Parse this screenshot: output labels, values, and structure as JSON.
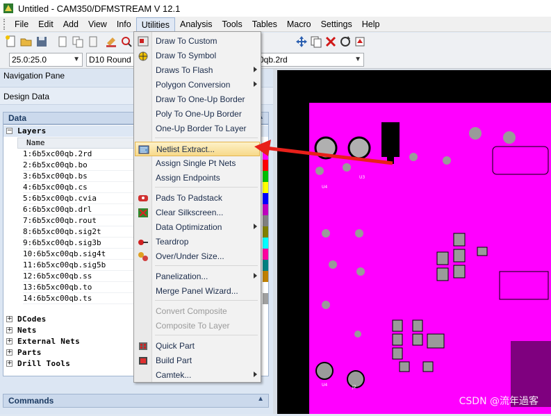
{
  "window": {
    "title": "Untitled  -  CAM350/DFMSTREAM V 12.1"
  },
  "menubar": [
    "File",
    "Edit",
    "Add",
    "View",
    "Info",
    "Utilities",
    "Analysis",
    "Tools",
    "Tables",
    "Macro",
    "Settings",
    "Help"
  ],
  "toolbar2": {
    "coord_value": "25.0:25.0",
    "dcode_value": "D10  Round",
    "layer_value": "0qb.2rd"
  },
  "nav": {
    "pane_title": "Navigation Pane",
    "design_data": "Design Data",
    "data_header": "Data",
    "layers_label": "Layers",
    "column_name": "Name",
    "layers": [
      {
        "name": "1:6b5xc00qb.2rd",
        "color": "#ff00ff"
      },
      {
        "name": "2:6b5xc00qb.bo",
        "color": "#ff0000"
      },
      {
        "name": "3:6b5xc00qb.bs",
        "color": "#00c000"
      },
      {
        "name": "4:6b5xc00qb.cs",
        "color": "#ffff00"
      },
      {
        "name": "5:6b5xc00qb.cvia",
        "color": "#0000ff"
      },
      {
        "name": "6:6b5xc00qb.drl",
        "color": "#c000c0"
      },
      {
        "name": "7:6b5xc00qb.rout",
        "color": "#808080"
      },
      {
        "name": "8:6b5xc00qb.sig2t",
        "color": "#808000"
      },
      {
        "name": "9:6b5xc00qb.sig3b",
        "color": "#00ffff"
      },
      {
        "name": "10:6b5xc00qb.sig4t",
        "color": "#ff00a0"
      },
      {
        "name": "11:6b5xc00qb.sig5b",
        "color": "#008080"
      },
      {
        "name": "12:6b5xc00qb.ss",
        "color": "#c08000"
      },
      {
        "name": "13:6b5xc00qb.to",
        "color": "#ffffff"
      },
      {
        "name": "14:6b5xc00qb.ts",
        "color": "#a0a0a0"
      }
    ],
    "groups": [
      "DCodes",
      "Nets",
      "External Nets",
      "Parts",
      "Drill Tools"
    ],
    "commands": "Commands"
  },
  "utilities_menu": {
    "items": [
      {
        "label": "Draw To Custom",
        "icon": "draw-custom-icon",
        "submenu": false,
        "disabled": false
      },
      {
        "label": "Draw To Symbol",
        "icon": "draw-symbol-icon",
        "submenu": false,
        "disabled": false
      },
      {
        "label": "Draws To Flash",
        "icon": "",
        "submenu": true,
        "disabled": false
      },
      {
        "label": "Polygon Conversion",
        "icon": "",
        "submenu": true,
        "disabled": false
      },
      {
        "label": "Draw To One-Up Border",
        "icon": "",
        "submenu": false,
        "disabled": false
      },
      {
        "label": "Poly To One-Up Border",
        "icon": "",
        "submenu": false,
        "disabled": false
      },
      {
        "label": "One-Up Border To Layer",
        "icon": "",
        "submenu": false,
        "disabled": false
      },
      {
        "label": "Netlist Extract...",
        "icon": "netlist-extract-icon",
        "submenu": false,
        "disabled": false,
        "highlighted": true
      },
      {
        "label": "Assign Single Pt Nets",
        "icon": "",
        "submenu": false,
        "disabled": false
      },
      {
        "label": "Assign Endpoints",
        "icon": "",
        "submenu": false,
        "disabled": false
      },
      {
        "label": "Pads To Padstack",
        "icon": "pads-padstack-icon",
        "submenu": false,
        "disabled": false
      },
      {
        "label": "Clear Silkscreen...",
        "icon": "clear-silkscreen-icon",
        "submenu": false,
        "disabled": false
      },
      {
        "label": "Data Optimization",
        "icon": "",
        "submenu": true,
        "disabled": false
      },
      {
        "label": "Teardrop",
        "icon": "teardrop-icon",
        "submenu": false,
        "disabled": false
      },
      {
        "label": "Over/Under Size...",
        "icon": "over-under-size-icon",
        "submenu": false,
        "disabled": false
      },
      {
        "label": "Panelization...",
        "icon": "",
        "submenu": true,
        "disabled": false
      },
      {
        "label": "Merge Panel Wizard...",
        "icon": "",
        "submenu": false,
        "disabled": false
      },
      {
        "label": "Convert Composite",
        "icon": "",
        "submenu": false,
        "disabled": true
      },
      {
        "label": "Composite To Layer",
        "icon": "",
        "submenu": false,
        "disabled": true
      },
      {
        "label": "Quick Part",
        "icon": "quick-part-icon",
        "submenu": false,
        "disabled": false
      },
      {
        "label": "Build Part",
        "icon": "build-part-icon",
        "submenu": false,
        "disabled": false
      },
      {
        "label": "Camtek...",
        "icon": "",
        "submenu": true,
        "disabled": false
      }
    ]
  },
  "pcb_labels": [
    "U4",
    "J2",
    "U3",
    "U4"
  ],
  "watermark": "CSDN @流年過客",
  "colors": {
    "pcb_copper": "#ff00ff",
    "pcb_background": "#000000",
    "arrow": "#e8201a",
    "highlight": "#f7d989"
  }
}
